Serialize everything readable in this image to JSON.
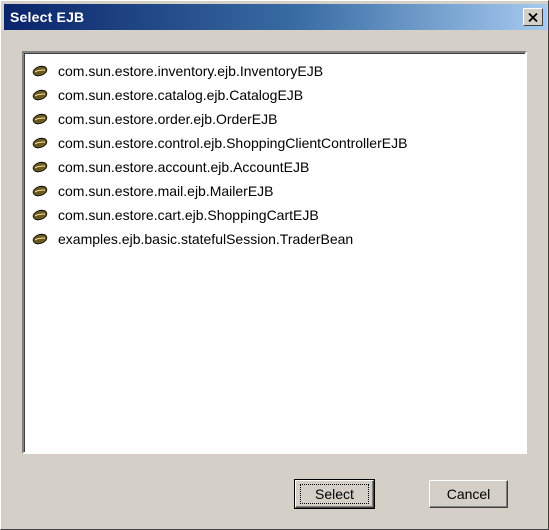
{
  "window": {
    "title": "Select EJB",
    "close_symbol": "×"
  },
  "ejb_list": {
    "items": [
      {
        "label": "com.sun.estore.inventory.ejb.InventoryEJB",
        "icon": "bean-icon"
      },
      {
        "label": "com.sun.estore.catalog.ejb.CatalogEJB",
        "icon": "bean-icon"
      },
      {
        "label": "com.sun.estore.order.ejb.OrderEJB",
        "icon": "bean-icon"
      },
      {
        "label": "com.sun.estore.control.ejb.ShoppingClientControllerEJB",
        "icon": "bean-icon"
      },
      {
        "label": "com.sun.estore.account.ejb.AccountEJB",
        "icon": "bean-icon"
      },
      {
        "label": "com.sun.estore.mail.ejb.MailerEJB",
        "icon": "bean-icon"
      },
      {
        "label": "com.sun.estore.cart.ejb.ShoppingCartEJB",
        "icon": "bean-icon"
      },
      {
        "label": "examples.ejb.basic.statefulSession.TraderBean",
        "icon": "bean-icon"
      }
    ]
  },
  "buttons": {
    "select_label": "Select",
    "cancel_label": "Cancel"
  },
  "colors": {
    "title_start": "#0a246a",
    "title_end": "#a6caf0",
    "face": "#d4d0c8"
  }
}
